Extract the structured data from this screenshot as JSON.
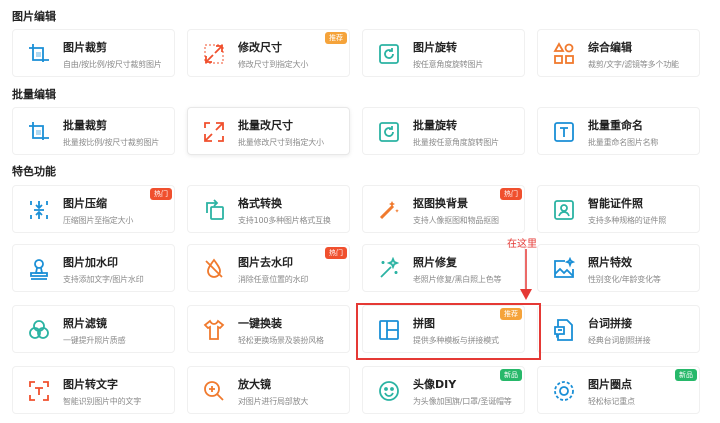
{
  "sections": {
    "s1": "图片编辑",
    "s2": "批量编辑",
    "s3": "特色功能"
  },
  "cards": {
    "c1": {
      "title": "图片裁剪",
      "desc": "自由/按比例/按尺寸裁剪图片",
      "icon": "crop-icon"
    },
    "c2": {
      "title": "修改尺寸",
      "desc": "修改尺寸到指定大小",
      "badge": "推荐",
      "icon": "resize-icon"
    },
    "c3": {
      "title": "图片旋转",
      "desc": "按任意角度旋转图片",
      "icon": "rotate-icon"
    },
    "c4": {
      "title": "综合编辑",
      "desc": "裁剪/文字/滤镜等多个功能",
      "icon": "shapes-icon"
    },
    "c5": {
      "title": "批量裁剪",
      "desc": "批量按比例/按尺寸裁剪图片",
      "icon": "crop-icon"
    },
    "c6": {
      "title": "批量改尺寸",
      "desc": "批量修改尺寸到指定大小",
      "icon": "resize-icon"
    },
    "c7": {
      "title": "批量旋转",
      "desc": "批量按任意角度旋转图片",
      "icon": "rotate-icon"
    },
    "c8": {
      "title": "批量重命名",
      "desc": "批量重命名图片名称",
      "icon": "text-t-icon"
    },
    "c9": {
      "title": "图片压缩",
      "desc": "压缩图片至指定大小",
      "badge": "热门",
      "icon": "compress-icon"
    },
    "c10": {
      "title": "格式转换",
      "desc": "支持100多种图片格式互换",
      "icon": "convert-icon"
    },
    "c11": {
      "title": "抠图换背景",
      "desc": "支持人像抠图和物品抠图",
      "badge": "热门",
      "icon": "cutout-icon"
    },
    "c12": {
      "title": "智能证件照",
      "desc": "支持多种规格的证件照",
      "icon": "id-photo-icon"
    },
    "c13": {
      "title": "图片加水印",
      "desc": "支持添加文字/图片水印",
      "icon": "stamp-icon"
    },
    "c14": {
      "title": "图片去水印",
      "desc": "消除任意位置的水印",
      "badge": "热门",
      "icon": "remove-watermark-icon"
    },
    "c15": {
      "title": "照片修复",
      "desc": "老照片修复/黑白照上色等",
      "icon": "magic-wand-icon"
    },
    "c16": {
      "title": "照片特效",
      "desc": "性别变化/年龄变化等",
      "icon": "effect-icon"
    },
    "c17": {
      "title": "照片滤镜",
      "desc": "一键提升照片质感",
      "icon": "filter-icon"
    },
    "c18": {
      "title": "一键换装",
      "desc": "轻松更换场景及装扮风格",
      "icon": "shirt-icon"
    },
    "c19": {
      "title": "拼图",
      "desc": "提供多种模板与拼接模式",
      "badge": "推荐",
      "icon": "collage-icon"
    },
    "c20": {
      "title": "台词拼接",
      "desc": "经典台词剧照拼接",
      "icon": "subtitle-icon"
    },
    "c21": {
      "title": "图片转文字",
      "desc": "智能识别图片中的文字",
      "icon": "ocr-icon"
    },
    "c22": {
      "title": "放大镜",
      "desc": "对图片进行局部放大",
      "icon": "magnifier-icon"
    },
    "c23": {
      "title": "头像DIY",
      "desc": "为头像加国旗/口罩/圣诞帽等",
      "badge": "新品",
      "icon": "smiley-icon"
    },
    "c24": {
      "title": "图片圈点",
      "desc": "轻松标记重点",
      "badge": "新品",
      "icon": "circle-mark-icon"
    }
  },
  "annotation": {
    "text": "在这里"
  },
  "colors": {
    "accent": "#1a8fd6",
    "hot": "#f0502e",
    "recommend": "#f5a33a",
    "new": "#27b86a",
    "annotation": "#e53935"
  }
}
